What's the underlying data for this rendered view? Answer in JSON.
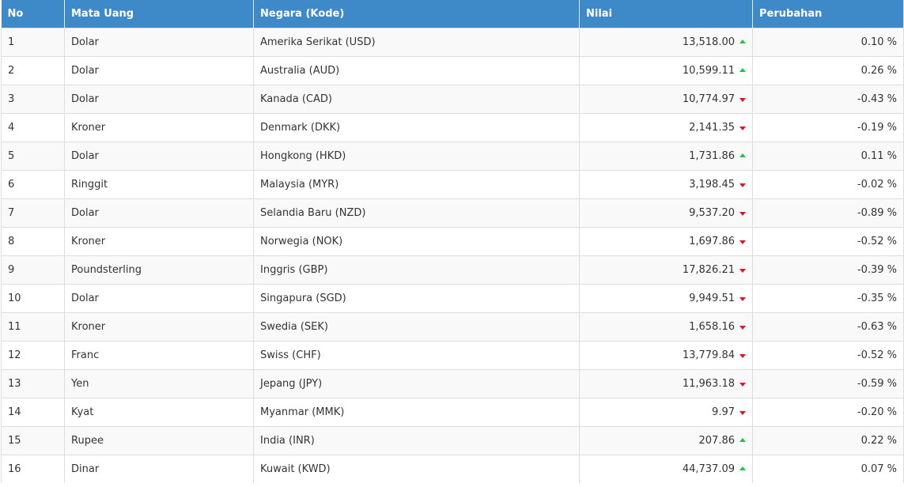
{
  "table": {
    "headers": [
      "No",
      "Mata Uang",
      "Negara (Kode)",
      "Nilai",
      "Perubahan"
    ],
    "rows": [
      {
        "no": "1",
        "currency": "Dolar",
        "country": "Amerika Serikat (USD)",
        "value": "13,518.00",
        "trend": "up",
        "change": "0.10 %"
      },
      {
        "no": "2",
        "currency": "Dolar",
        "country": "Australia (AUD)",
        "value": "10,599.11",
        "trend": "up",
        "change": "0.26 %"
      },
      {
        "no": "3",
        "currency": "Dolar",
        "country": "Kanada (CAD)",
        "value": "10,774.97",
        "trend": "down",
        "change": "-0.43 %"
      },
      {
        "no": "4",
        "currency": "Kroner",
        "country": "Denmark (DKK)",
        "value": "2,141.35",
        "trend": "down",
        "change": "-0.19 %"
      },
      {
        "no": "5",
        "currency": "Dolar",
        "country": "Hongkong (HKD)",
        "value": "1,731.86",
        "trend": "up",
        "change": "0.11 %"
      },
      {
        "no": "6",
        "currency": "Ringgit",
        "country": "Malaysia (MYR)",
        "value": "3,198.45",
        "trend": "down",
        "change": "-0.02 %"
      },
      {
        "no": "7",
        "currency": "Dolar",
        "country": "Selandia Baru (NZD)",
        "value": "9,537.20",
        "trend": "down",
        "change": "-0.89 %"
      },
      {
        "no": "8",
        "currency": "Kroner",
        "country": "Norwegia (NOK)",
        "value": "1,697.86",
        "trend": "down",
        "change": "-0.52 %"
      },
      {
        "no": "9",
        "currency": "Poundsterling",
        "country": "Inggris (GBP)",
        "value": "17,826.21",
        "trend": "down",
        "change": "-0.39 %"
      },
      {
        "no": "10",
        "currency": "Dolar",
        "country": "Singapura (SGD)",
        "value": "9,949.51",
        "trend": "down",
        "change": "-0.35 %"
      },
      {
        "no": "11",
        "currency": "Kroner",
        "country": "Swedia (SEK)",
        "value": "1,658.16",
        "trend": "down",
        "change": "-0.63 %"
      },
      {
        "no": "12",
        "currency": "Franc",
        "country": "Swiss (CHF)",
        "value": "13,779.84",
        "trend": "down",
        "change": "-0.52 %"
      },
      {
        "no": "13",
        "currency": "Yen",
        "country": "Jepang (JPY)",
        "value": "11,963.18",
        "trend": "down",
        "change": "-0.59 %"
      },
      {
        "no": "14",
        "currency": "Kyat",
        "country": "Myanmar (MMK)",
        "value": "9.97",
        "trend": "down",
        "change": "-0.20 %"
      },
      {
        "no": "15",
        "currency": "Rupee",
        "country": "India (INR)",
        "value": "207.86",
        "trend": "up",
        "change": "0.22 %"
      },
      {
        "no": "16",
        "currency": "Dinar",
        "country": "Kuwait (KWD)",
        "value": "44,737.09",
        "trend": "up",
        "change": "0.07 %"
      }
    ]
  },
  "colors": {
    "header_bg": "#3e8ac9",
    "up": "#21c24a",
    "down": "#e0122b"
  },
  "icons": {
    "up": "arrow-up-icon",
    "down": "arrow-down-icon"
  }
}
